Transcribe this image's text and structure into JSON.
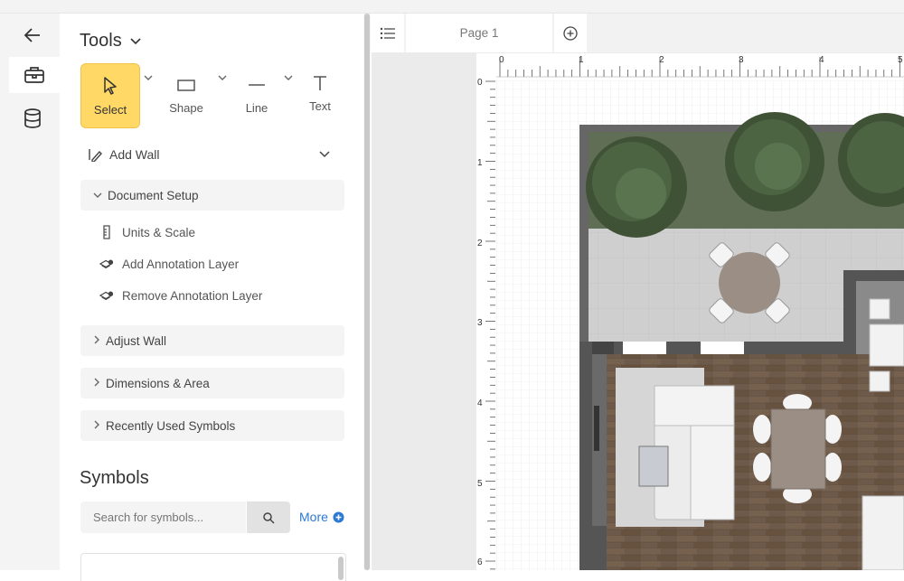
{
  "rail": {
    "back_icon": "arrow-left-icon",
    "tools_icon": "toolbox-icon",
    "data_icon": "database-icon"
  },
  "panel": {
    "title": "Tools",
    "tools": [
      {
        "label": "Select",
        "icon": "cursor-icon"
      },
      {
        "label": "Shape",
        "icon": "rectangle-icon"
      },
      {
        "label": "Line",
        "icon": "line-icon"
      },
      {
        "label": "Text",
        "icon": "text-icon"
      }
    ],
    "add_wall": "Add Wall",
    "document_setup": "Document Setup",
    "document_setup_items": [
      "Units & Scale",
      "Add Annotation Layer",
      "Remove Annotation Layer"
    ],
    "adjust_wall": "Adjust Wall",
    "dimensions_area": "Dimensions & Area",
    "recently_used": "Recently Used Symbols",
    "symbols_title": "Symbols",
    "search_placeholder": "Search for symbols...",
    "more_label": "More"
  },
  "canvas": {
    "page_tab": "Page 1",
    "ruler_h": [
      "0",
      "1",
      "2",
      "3",
      "4",
      "5"
    ],
    "ruler_v": [
      "0",
      "1",
      "2",
      "3",
      "4",
      "5",
      "6"
    ]
  },
  "colors": {
    "accent_select": "#ffd866",
    "link_blue": "#2a7ad4",
    "wall": "#555555",
    "floor_wood": "#6e5a4a"
  }
}
